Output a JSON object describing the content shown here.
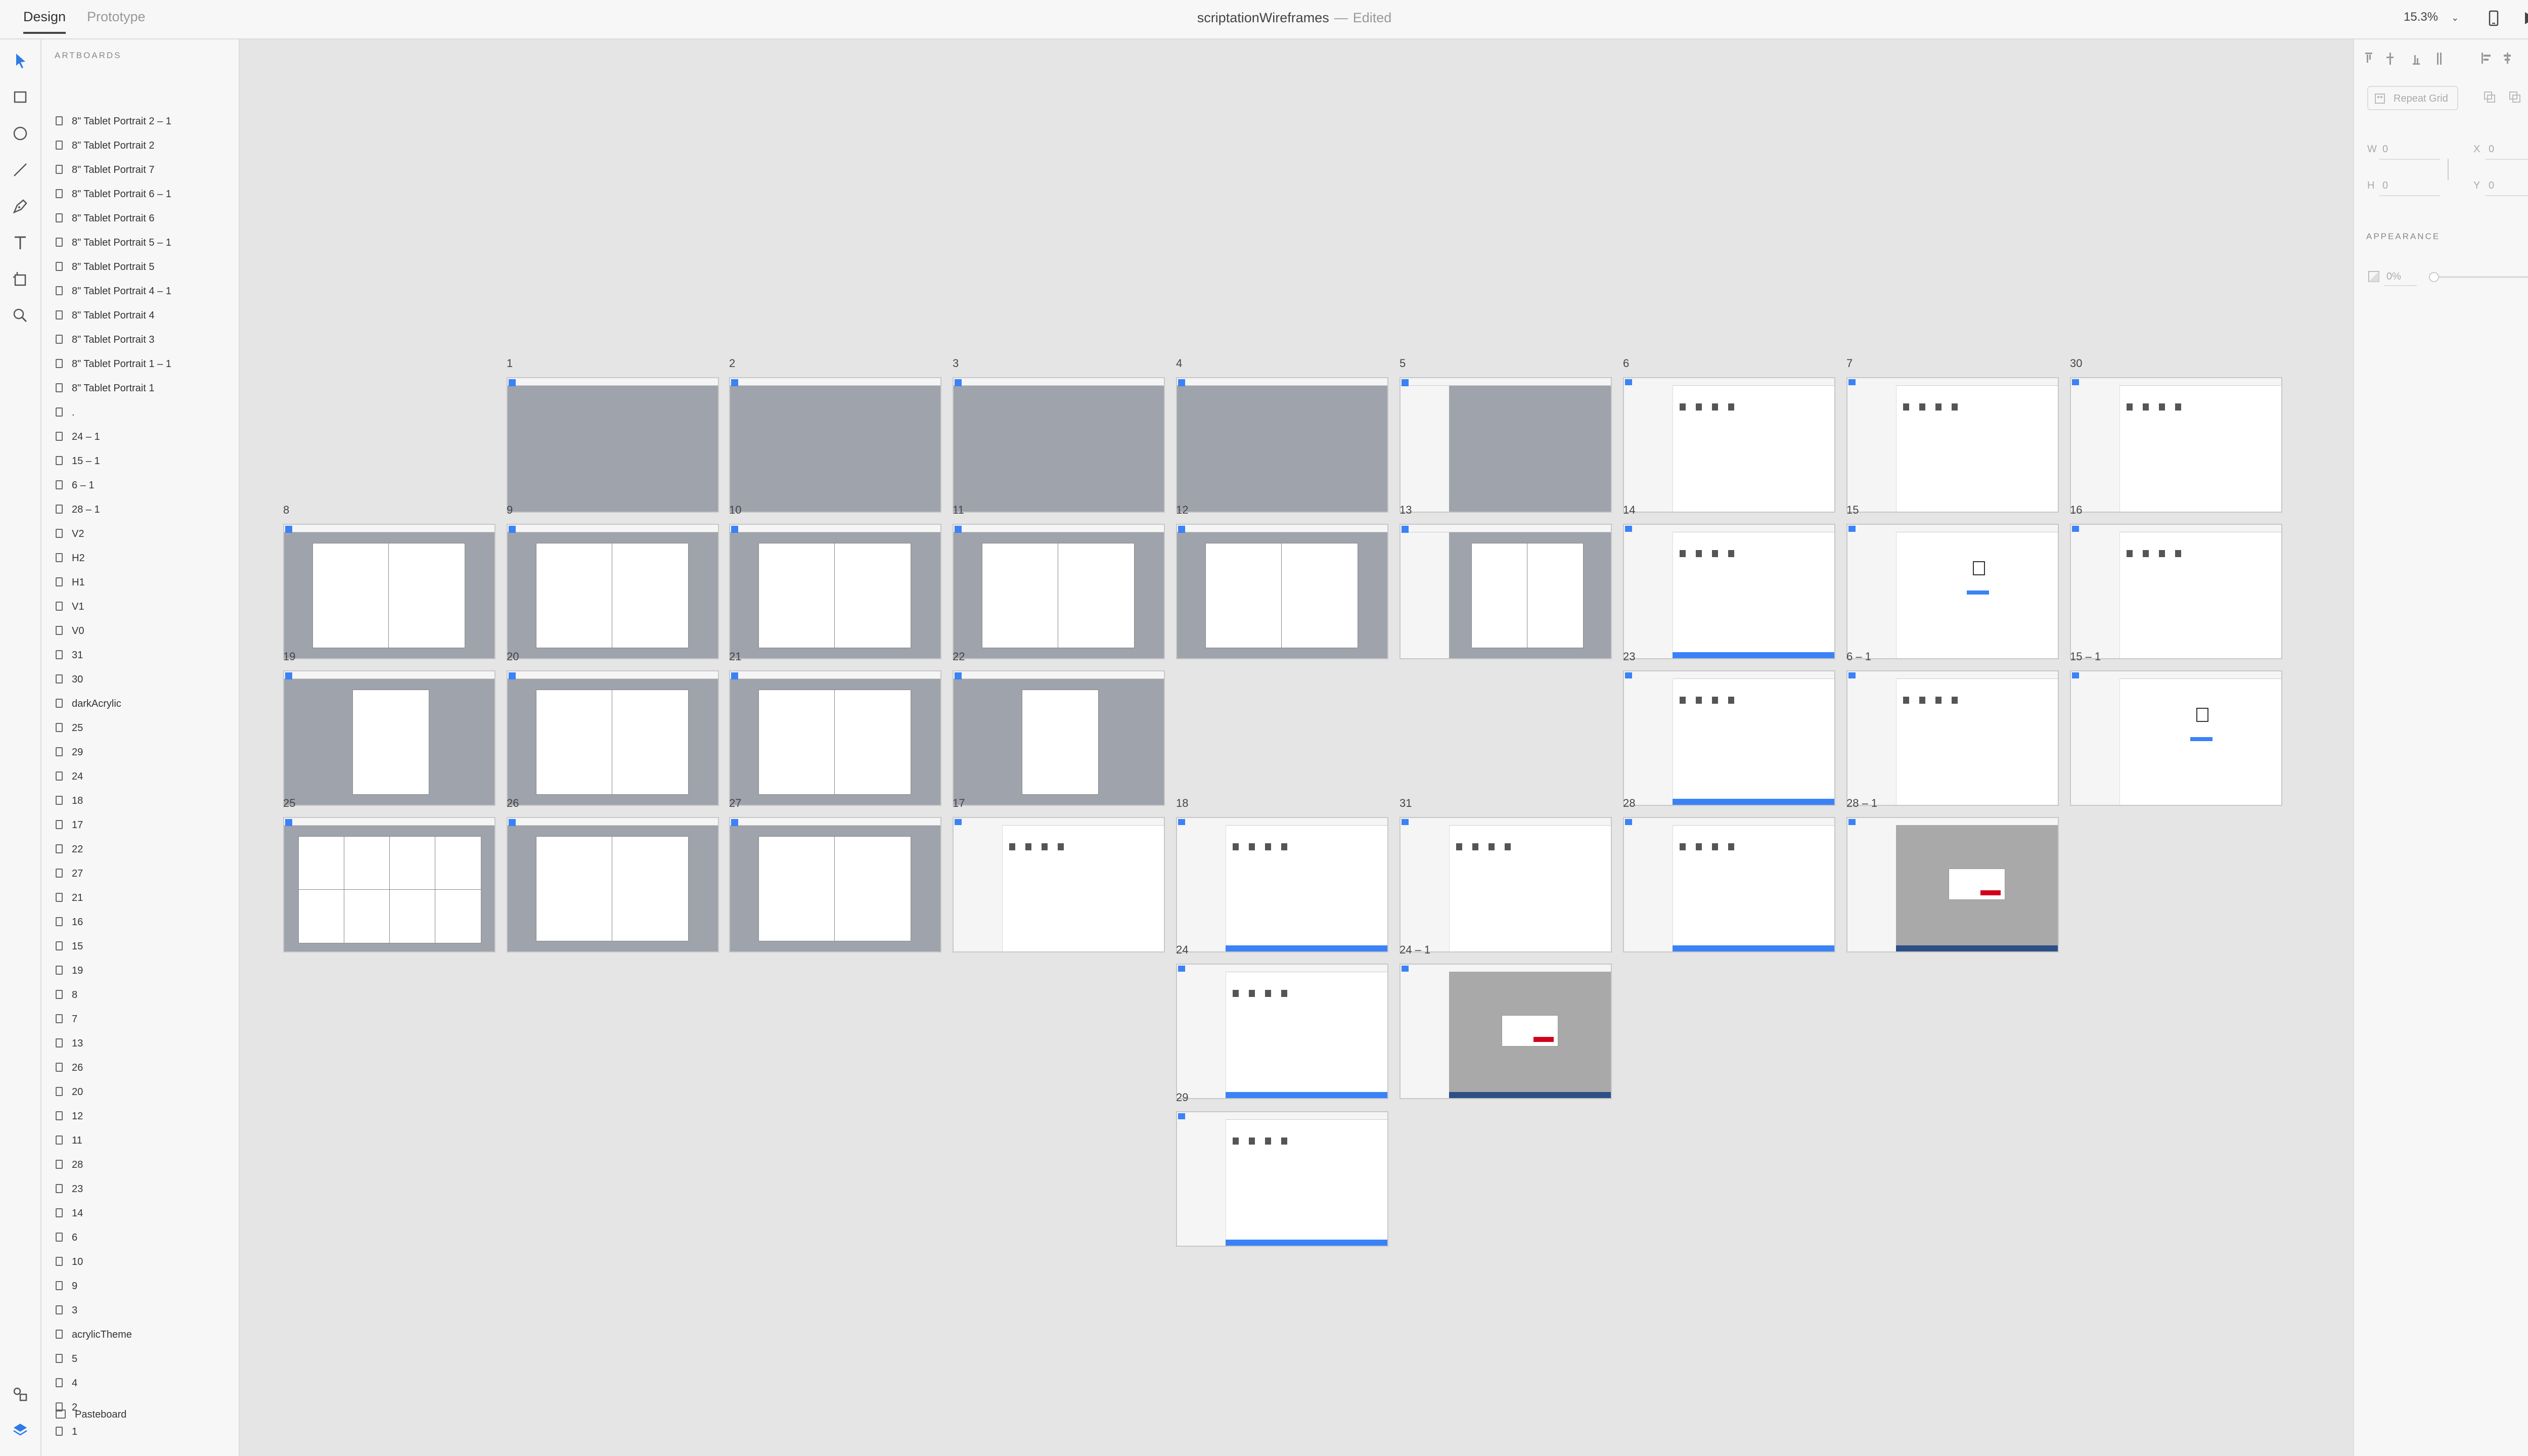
{
  "header": {
    "tabs": [
      "Design",
      "Prototype"
    ],
    "document_title": "scriptationWireframes",
    "separator": "—",
    "status": "Edited",
    "zoom": "15.3%"
  },
  "icons": {
    "toolbar": [
      "select-icon",
      "rectangle-icon",
      "ellipse-icon",
      "line-icon",
      "pen-icon",
      "text-icon",
      "artboard-icon",
      "zoom-icon"
    ],
    "bottom": [
      "plugins-icon",
      "layers-icon"
    ],
    "top_right": [
      "device-preview-icon",
      "play-icon",
      "share-icon"
    ]
  },
  "layers": {
    "heading": "ARTBOARDS",
    "items": [
      "8\" Tablet Portrait 2 – 1",
      "8\" Tablet Portrait 2",
      "8\" Tablet Portrait 7",
      "8\" Tablet Portrait 6 – 1",
      "8\" Tablet Portrait 6",
      "8\" Tablet Portrait 5 – 1",
      "8\" Tablet Portrait 5",
      "8\" Tablet Portrait 4 – 1",
      "8\" Tablet Portrait 4",
      "8\" Tablet Portrait 3",
      "8\" Tablet Portrait 1 – 1",
      "8\" Tablet Portrait 1",
      ".",
      "24 – 1",
      "15 – 1",
      "6 – 1",
      "28 – 1",
      "V2",
      "H2",
      "H1",
      "V1",
      "V0",
      "31",
      "30",
      "darkAcrylic",
      "25",
      "29",
      "24",
      "18",
      "17",
      "22",
      "27",
      "21",
      "16",
      "15",
      "19",
      "8",
      "7",
      "13",
      "26",
      "20",
      "12",
      "11",
      "28",
      "23",
      "14",
      "6",
      "10",
      "9",
      "3",
      "acrylicTheme",
      "5",
      "4",
      "2",
      "1"
    ],
    "pasteboard": "Pasteboard"
  },
  "artboards": [
    {
      "label": "1"
    },
    {
      "label": "2"
    },
    {
      "label": "3"
    },
    {
      "label": "4"
    },
    {
      "label": "5"
    },
    {
      "label": "6"
    },
    {
      "label": "7"
    },
    {
      "label": "30"
    },
    {
      "label": "8"
    },
    {
      "label": "9"
    },
    {
      "label": "10"
    },
    {
      "label": "11"
    },
    {
      "label": "12"
    },
    {
      "label": "13"
    },
    {
      "label": "14"
    },
    {
      "label": "15"
    },
    {
      "label": "16"
    },
    {
      "label": "19"
    },
    {
      "label": "20"
    },
    {
      "label": "21"
    },
    {
      "label": "22"
    },
    {
      "label": "23"
    },
    {
      "label": "6 – 1"
    },
    {
      "label": "15 – 1"
    },
    {
      "label": "25"
    },
    {
      "label": "26"
    },
    {
      "label": "27"
    },
    {
      "label": "17"
    },
    {
      "label": "18"
    },
    {
      "label": "31"
    },
    {
      "label": "28"
    },
    {
      "label": "28 – 1"
    },
    {
      "label": "24"
    },
    {
      "label": "24 – 1"
    },
    {
      "label": "29"
    }
  ],
  "inspector": {
    "repeat_grid": "Repeat Grid",
    "w_label": "W",
    "w_value": "0",
    "x_label": "X",
    "x_value": "0",
    "h_label": "H",
    "h_value": "0",
    "y_label": "Y",
    "y_value": "0",
    "appearance": "APPEARANCE",
    "opacity": "0%"
  },
  "colors": {
    "accent": "#3b82f6",
    "danger": "#d0021b",
    "canvas": "#e5e5e5",
    "panel": "#f7f7f7",
    "artboard_gray": "#9fa3ab"
  }
}
